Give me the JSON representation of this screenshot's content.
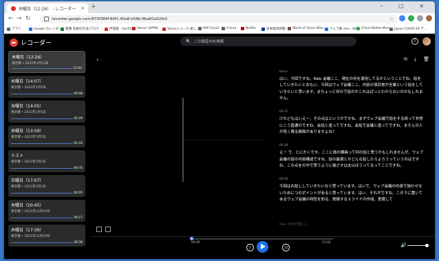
{
  "browser": {
    "tab_title": "木曜日（12:26） - レコーダー",
    "tab_close": "×",
    "new_tab": "+",
    "window_controls": "– ▢ ×",
    "url": "recorder.google.com/87f0384f-80f1-40a8-b58b-ffba81a02fe3",
    "bookmarks": [
      {
        "label": "アプリ",
        "color": "#5f6368"
      },
      {
        "label": "Google カレンダー",
        "color": "#1a73e8"
      },
      {
        "label": "帳簿 先頭の方法/ブログ...",
        "color": "#188038"
      },
      {
        "label": "戸田塾 - YouTube",
        "color": "#d93025"
      },
      {
        "label": "Yahoo! JAPAN",
        "color": "#c5221f"
      },
      {
        "label": "Yahooニュース 楽し...",
        "color": "#c5221f"
      },
      {
        "label": "Wifi Cloud",
        "color": "#5f6368"
      },
      {
        "label": "iCloud",
        "color": "#5f6368"
      },
      {
        "label": "Netflix",
        "color": "#b31217"
      },
      {
        "label": "日本経済新聞",
        "color": "#0b3d91"
      },
      {
        "label": "World of Tanks Blitz...",
        "color": "#6d4c41"
      },
      {
        "label": "ウェブ素 slos - Web...",
        "color": "#1a73e8"
      },
      {
        "label": "Client Wallet Mem...",
        "color": "#34a853"
      },
      {
        "label": "Japan COVID-19 デ...",
        "color": "#5f6368"
      }
    ]
  },
  "app": {
    "name": "レコーダー",
    "search_placeholder": "この録音内を検索",
    "search_icon": "🔍",
    "help_icon": "?",
    "back_icon": "‹",
    "actions": {
      "share": "⟲",
      "download": "⤓",
      "delete": "🗑"
    }
  },
  "recordings": [
    {
      "title": "木曜日（12:26）",
      "subtitle": "東京都 • 2022年1月13日",
      "duration": "11:02",
      "selected": true
    },
    {
      "title": "水曜日（14:07）",
      "subtitle": "東京都 • 2022年1月5日",
      "duration": "00:08",
      "selected": false
    },
    {
      "title": "水曜日（14:05）",
      "subtitle": "東京都 • 2022年1月5日",
      "duration": "01:29",
      "selected": false
    },
    {
      "title": "水曜日（13:59）",
      "subtitle": "東京都 • 2022年1月5日",
      "duration": "01:44",
      "selected": false
    },
    {
      "title": "テスト",
      "subtitle": "東京都 • 2022年1月5日",
      "duration": "00:35",
      "selected": false
    },
    {
      "title": "日曜日（17:07）",
      "subtitle": "東京都 • 2022年1月2日",
      "duration": "00:05",
      "selected": false
    },
    {
      "title": "木曜日（20:45）",
      "subtitle": "東京都 • 2021年12月29日",
      "duration": "00:17",
      "selected": false
    },
    {
      "title": "木曜日（17:39）",
      "subtitle": "東京都 • 2021年12月29日",
      "duration": "00:38",
      "selected": false
    }
  ],
  "transcript": [
    {
      "time": "00:07",
      "text": "はい、今回ですね、Web 会議ここ、現在の何を運用してるかということでね、話をしていきたいとおもい、今回はウェブ会議ここ、内容の項目他が全業という話をしていきたいと思います。まちょっと何ので話のかこれはぱっとわからないのかもしれません。"
    },
    {
      "time": "00:37",
      "text": "けれどもはいえー、その点はというかですね、まずウェブ会議で話をする時って非常にこう普通のですね、会話と違ってですね、会話で会議と違ってですね、まそんの人が良く喋る側面がありますよね？"
    },
    {
      "time": "00:44",
      "text": "えー で、とにかくです。ここに員の横画って何の話と思うかもしれませんが、ウェブ会議の話の内容構成ですね、話の最適とかどんな話したらよろうっていうのはですね、この点をの中で思うように揃さすは支以ほうってるってことですね。"
    },
    {
      "time": "00:56",
      "text": "今回はお話ししていきたいなと思っています。はいで、ウェブ会議の内容で該わせないためにつのポイントがあると思っています。はい、それがですね、この下に置いてあるウェブ会議の特性を知る、質疑するスライドの作成、意識して"
    }
  ],
  "fade_note": "Pixel での文字起こし",
  "player": {
    "current_time": "00:00",
    "total_time": "11:02",
    "progress": 0.0,
    "volume": 0.85,
    "rewind_label": "5",
    "forward_label": "10",
    "volume_icon": "🔊"
  },
  "colors": {
    "accent": "#1a73e8",
    "brand": "#e34234",
    "waveform": "#8ab4f8"
  }
}
